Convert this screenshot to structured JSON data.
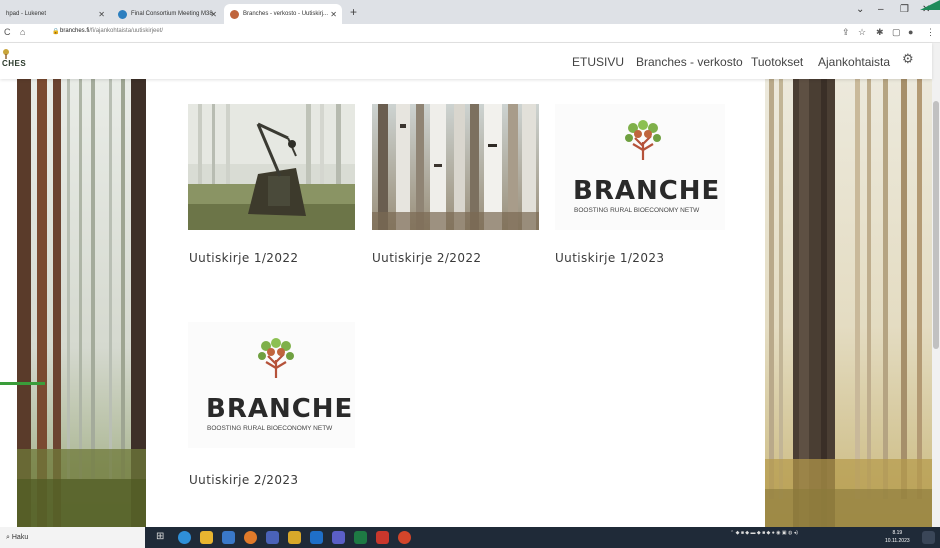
{
  "browser": {
    "tabs": [
      {
        "label": "hpad - Lukenet"
      },
      {
        "label": "Final Consortium Meeting M38"
      },
      {
        "label": "Branches - verkosto - Uutiskirj..."
      }
    ],
    "url_host": "branches.fi",
    "url_path": "/fi/ajankohtaista/uutiskirjeet/"
  },
  "site": {
    "logo_text": "CHES",
    "nav": [
      {
        "label": "ETUSIVU"
      },
      {
        "label": "Branches - verkosto"
      },
      {
        "label": "Tuotokset"
      },
      {
        "label": "Ajankohtaista"
      }
    ]
  },
  "newsletters": [
    {
      "title": "Uutiskirje 1/2022",
      "image": "harvester-photo"
    },
    {
      "title": "Uutiskirje 2/2022",
      "image": "birch-trunks-photo"
    },
    {
      "title": "Uutiskirje 1/2023",
      "image": "branches-logo"
    },
    {
      "title": "Uutiskirje 2/2023",
      "image": "branches-logo"
    }
  ],
  "brand": {
    "word": "BRANCHE",
    "tagline": "BOOSTING RURAL BIOECONOMY NETW"
  },
  "taskbar": {
    "search_label": "Haku",
    "time": "8.19",
    "date": "10.11.2023"
  },
  "colors": {
    "accent_green": "#3a9d3a",
    "tree_green": "#7fb04a",
    "trunk_red": "#b5523a"
  }
}
